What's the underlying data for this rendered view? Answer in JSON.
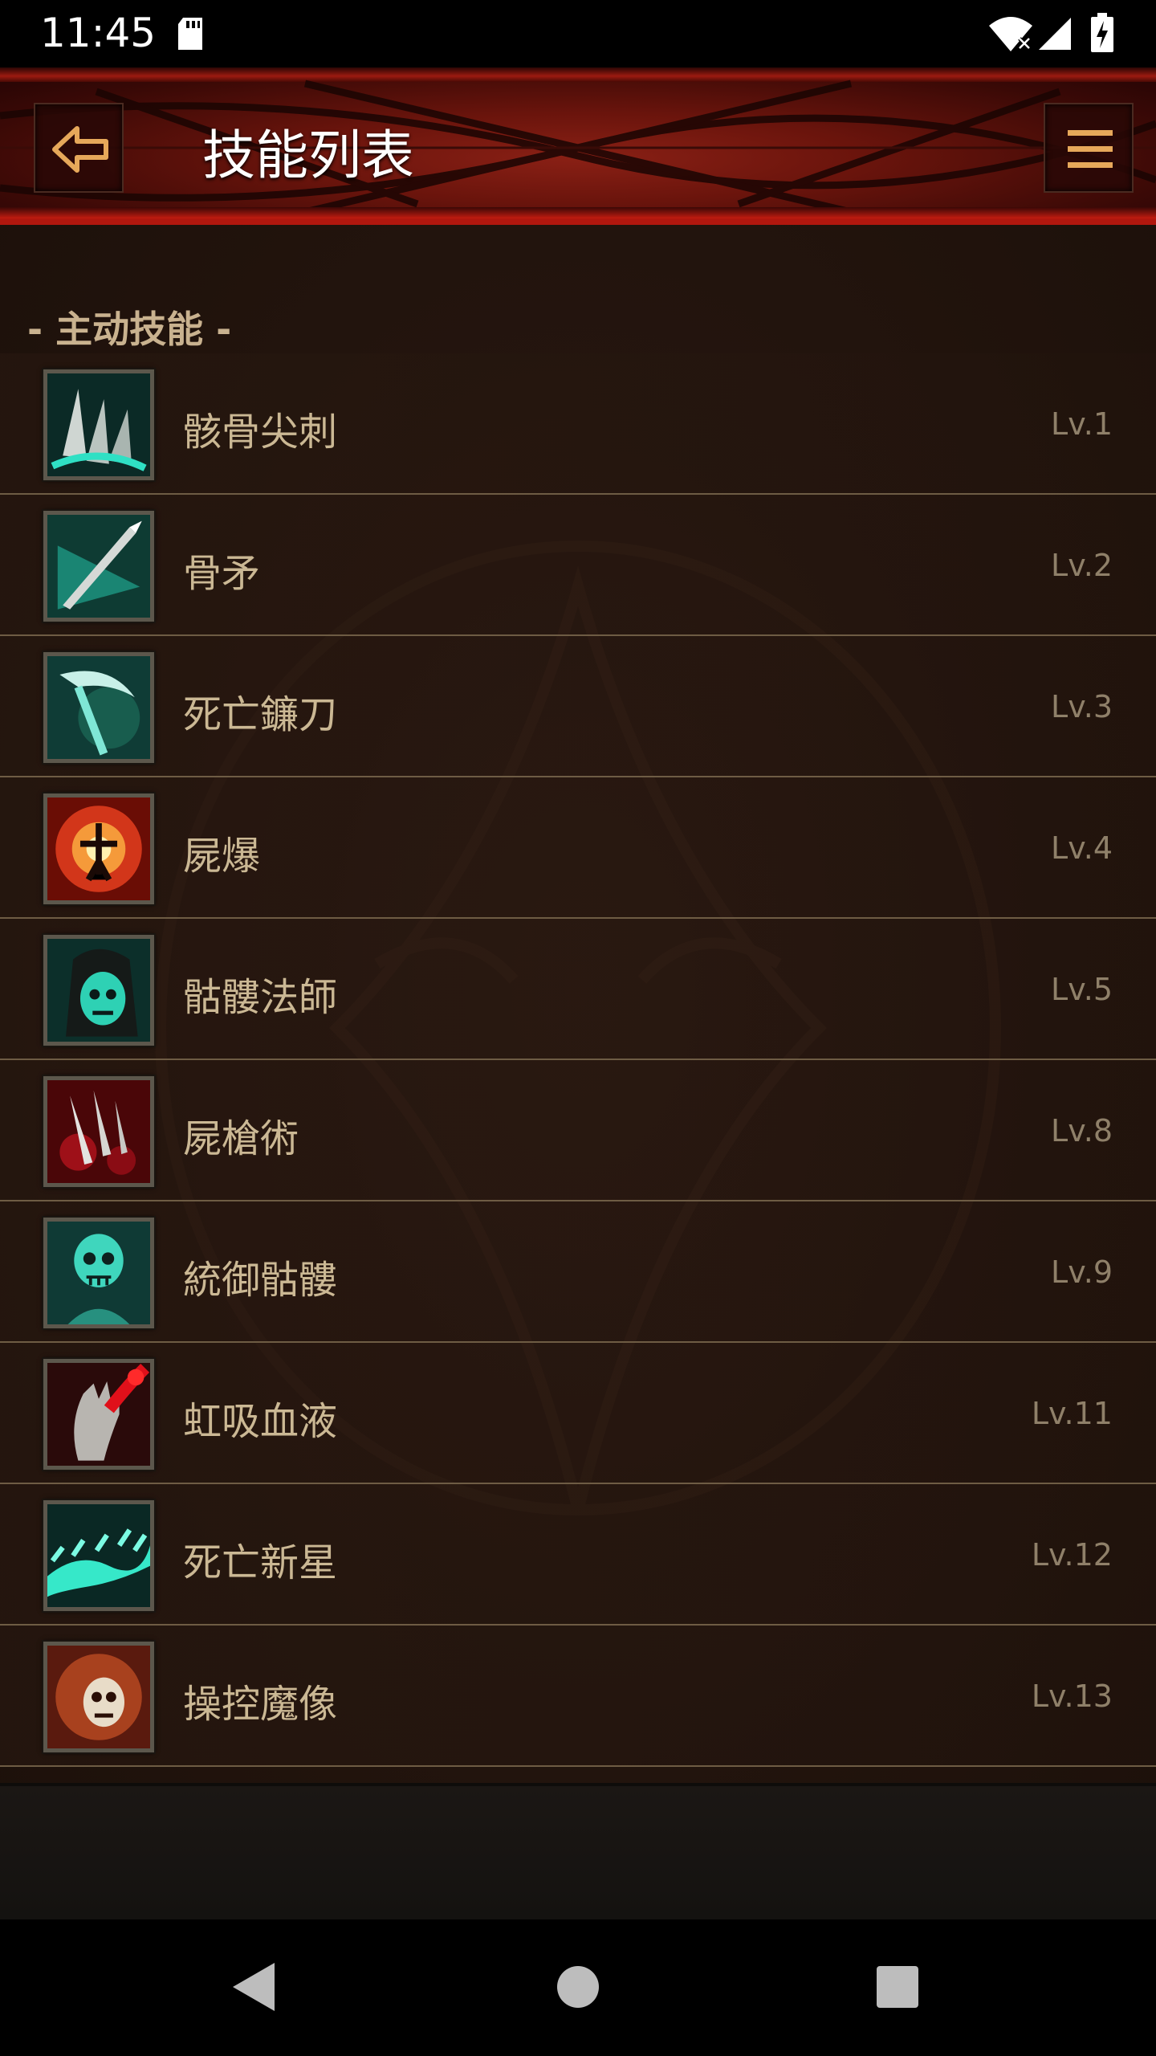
{
  "status_bar": {
    "time": "11:45"
  },
  "app_bar": {
    "title": "技能列表"
  },
  "section": {
    "header": "- 主动技能 -"
  },
  "skills": [
    {
      "name": "骸骨尖刺",
      "level": "Lv.1",
      "icon": "bone-spikes-icon",
      "color": "#2fb3a0"
    },
    {
      "name": "骨矛",
      "level": "Lv.2",
      "icon": "bone-spear-icon",
      "color": "#2fb3a0"
    },
    {
      "name": "死亡鐮刀",
      "level": "Lv.3",
      "icon": "grim-scythe-icon",
      "color": "#2fb3a0"
    },
    {
      "name": "屍爆",
      "level": "Lv.4",
      "icon": "corpse-explosion-icon",
      "color": "#e0521a"
    },
    {
      "name": "骷髏法師",
      "level": "Lv.5",
      "icon": "skeletal-mage-icon",
      "color": "#2fb3a0"
    },
    {
      "name": "屍槍術",
      "level": "Lv.8",
      "icon": "corpse-lance-icon",
      "color": "#b0121a"
    },
    {
      "name": "統御骷髏",
      "level": "Lv.9",
      "icon": "command-skeletons-icon",
      "color": "#2fb3a0"
    },
    {
      "name": "虹吸血液",
      "level": "Lv.11",
      "icon": "siphon-blood-icon",
      "color": "#b0121a"
    },
    {
      "name": "死亡新星",
      "level": "Lv.12",
      "icon": "death-nova-icon",
      "color": "#2fb3a0"
    },
    {
      "name": "操控魔像",
      "level": "Lv.13",
      "icon": "command-golem-icon",
      "color": "#c0562a"
    }
  ]
}
